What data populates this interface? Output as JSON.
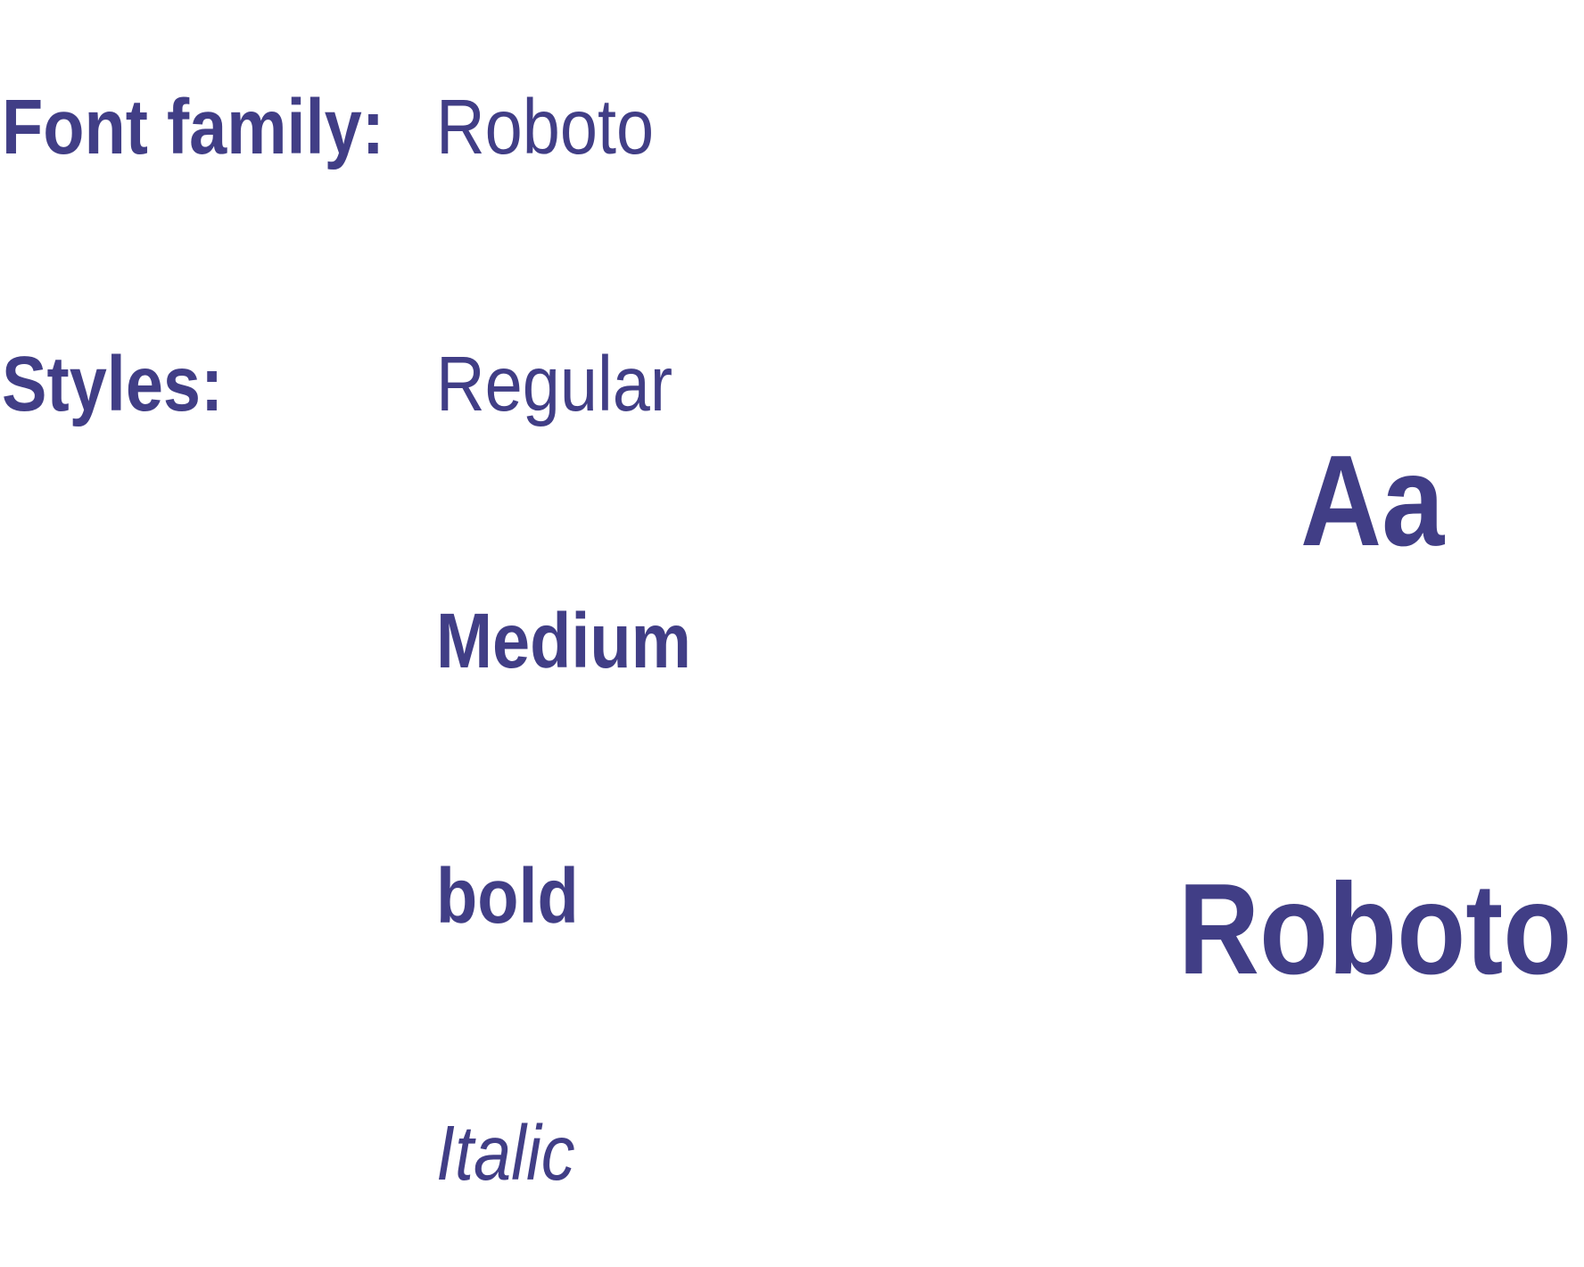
{
  "color": "#413e86",
  "font_family": {
    "label": "Font family:",
    "value": "Roboto"
  },
  "styles": {
    "label": "Styles:",
    "items": [
      {
        "label": "Regular",
        "weight": "regular"
      },
      {
        "label": "Medium",
        "weight": "medium"
      },
      {
        "label": "bold",
        "weight": "bold"
      },
      {
        "label": "Italic",
        "weight": "italic"
      }
    ]
  },
  "samples": {
    "glyphs": "Aa",
    "name": "Roboto"
  }
}
